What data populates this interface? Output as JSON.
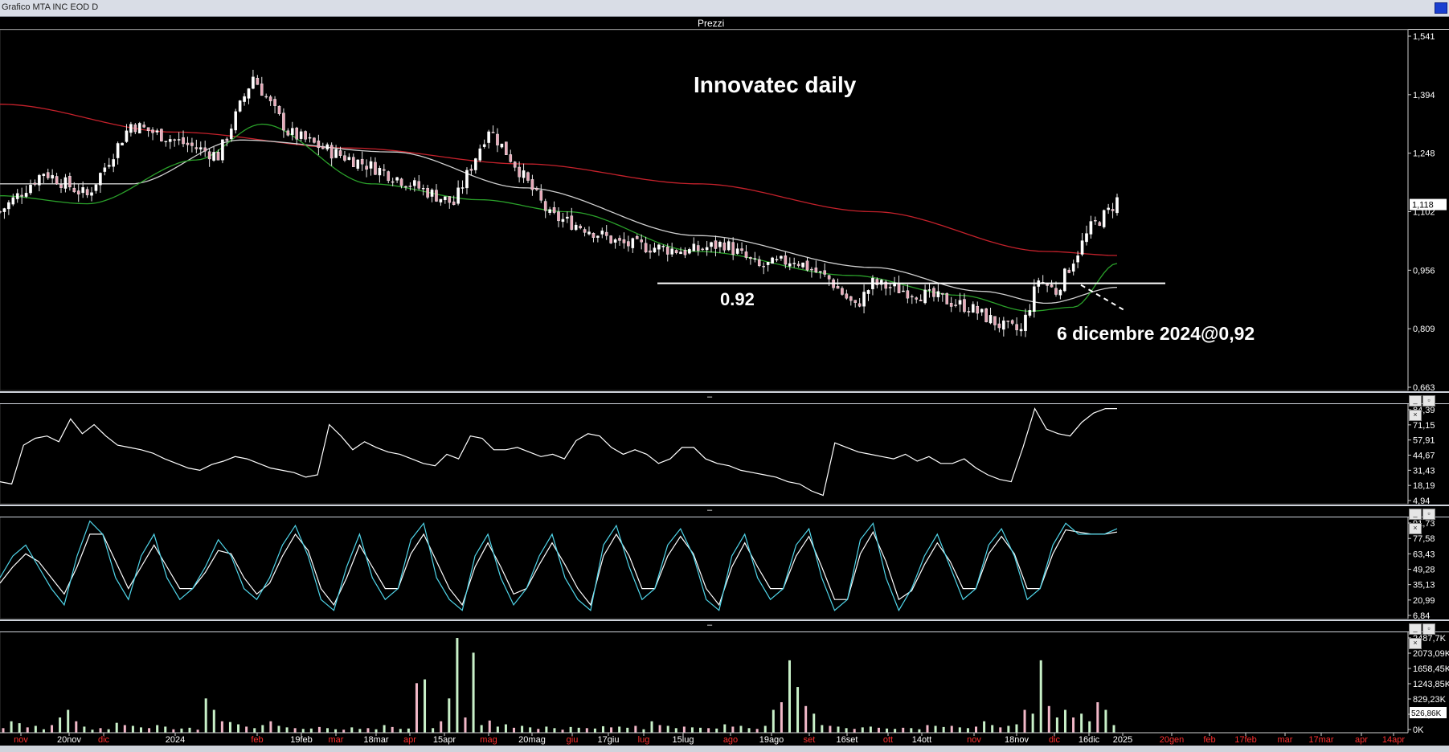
{
  "window": {
    "title": "Grafico MTA INC EOD D"
  },
  "panes": {
    "price_label": "Prezzi"
  },
  "annotations": {
    "title": "Innovatec daily",
    "support_label": "0.92",
    "date_label": "6 dicembre 2024@0,92"
  },
  "colors": {
    "background": "#000000",
    "ma_long": "#c4212b",
    "ma_mid": "#cfcfcf",
    "ma_short": "#2aa02a",
    "candle_up": "#ffffff",
    "candle_down": "#e8a8b8",
    "rsi": "#ffffff",
    "stoch_k": "#4fd4e8",
    "stoch_d": "#ffffff",
    "vol_up": "#c8f0c8",
    "vol_down": "#f2b8c8"
  },
  "x_axis": {
    "labels": [
      {
        "t": "nov",
        "c": "#ff3030"
      },
      {
        "t": "20nov",
        "c": "#ffffff"
      },
      {
        "t": "dic",
        "c": "#ff3030"
      },
      {
        "t": "2024",
        "c": "#ffffff"
      },
      {
        "t": "feb",
        "c": "#ff3030"
      },
      {
        "t": "19feb",
        "c": "#ffffff"
      },
      {
        "t": "mar",
        "c": "#ff3030"
      },
      {
        "t": "18mar",
        "c": "#ffffff"
      },
      {
        "t": "apr",
        "c": "#ff3030"
      },
      {
        "t": "15apr",
        "c": "#ffffff"
      },
      {
        "t": "mag",
        "c": "#ff3030"
      },
      {
        "t": "20mag",
        "c": "#ffffff"
      },
      {
        "t": "giu",
        "c": "#ff3030"
      },
      {
        "t": "17giu",
        "c": "#ffffff"
      },
      {
        "t": "lug",
        "c": "#ff3030"
      },
      {
        "t": "15lug",
        "c": "#ffffff"
      },
      {
        "t": "ago",
        "c": "#ff3030"
      },
      {
        "t": "19ago",
        "c": "#ffffff"
      },
      {
        "t": "set",
        "c": "#ff3030"
      },
      {
        "t": "16set",
        "c": "#ffffff"
      },
      {
        "t": "ott",
        "c": "#ff3030"
      },
      {
        "t": "14ott",
        "c": "#ffffff"
      },
      {
        "t": "nov",
        "c": "#ff3030"
      },
      {
        "t": "18nov",
        "c": "#ffffff"
      },
      {
        "t": "dic",
        "c": "#ff3030"
      },
      {
        "t": "16dic",
        "c": "#ffffff"
      },
      {
        "t": "2025",
        "c": "#ffffff"
      },
      {
        "t": "20gen",
        "c": "#ff3030"
      },
      {
        "t": "feb",
        "c": "#ff3030"
      },
      {
        "t": "17feb",
        "c": "#ff3030"
      },
      {
        "t": "mar",
        "c": "#ff3030"
      },
      {
        "t": "17mar",
        "c": "#ff3030"
      },
      {
        "t": "apr",
        "c": "#ff3030"
      },
      {
        "t": "14apr",
        "c": "#ff3030"
      }
    ]
  },
  "chart_data": [
    {
      "type": "candlestick",
      "pane": "Prezzi",
      "title": "Innovatec daily",
      "y_ticks": [
        "1,541",
        "1,394",
        "1,248",
        "1,102",
        "0,956",
        "0,809",
        "0,663"
      ],
      "ylim": [
        0.663,
        1.541
      ],
      "last_price": "1,118",
      "support_level": 0.92,
      "price_path": [
        {
          "x": 0,
          "y": 1.1
        },
        {
          "x": 10,
          "y": 1.2
        },
        {
          "x": 20,
          "y": 1.14
        },
        {
          "x": 30,
          "y": 1.32
        },
        {
          "x": 40,
          "y": 1.28
        },
        {
          "x": 50,
          "y": 1.24
        },
        {
          "x": 58,
          "y": 1.44
        },
        {
          "x": 66,
          "y": 1.3
        },
        {
          "x": 76,
          "y": 1.25
        },
        {
          "x": 86,
          "y": 1.21
        },
        {
          "x": 96,
          "y": 1.16
        },
        {
          "x": 104,
          "y": 1.12
        },
        {
          "x": 112,
          "y": 1.31
        },
        {
          "x": 118,
          "y": 1.22
        },
        {
          "x": 126,
          "y": 1.09
        },
        {
          "x": 134,
          "y": 1.06
        },
        {
          "x": 142,
          "y": 1.02
        },
        {
          "x": 150,
          "y": 1.01
        },
        {
          "x": 158,
          "y": 1.0
        },
        {
          "x": 166,
          "y": 1.02
        },
        {
          "x": 174,
          "y": 0.96
        },
        {
          "x": 182,
          "y": 0.98
        },
        {
          "x": 190,
          "y": 0.93
        },
        {
          "x": 196,
          "y": 0.86
        },
        {
          "x": 200,
          "y": 0.92
        },
        {
          "x": 208,
          "y": 0.9
        },
        {
          "x": 216,
          "y": 0.88
        },
        {
          "x": 222,
          "y": 0.86
        },
        {
          "x": 230,
          "y": 0.81
        },
        {
          "x": 234,
          "y": 0.8
        },
        {
          "x": 238,
          "y": 0.93
        },
        {
          "x": 242,
          "y": 0.9
        },
        {
          "x": 246,
          "y": 0.98
        },
        {
          "x": 250,
          "y": 1.06
        },
        {
          "x": 254,
          "y": 1.1
        },
        {
          "x": 256,
          "y": 1.13
        }
      ],
      "moving_averages": [
        {
          "name": "MA long",
          "color": "#c4212b",
          "points": [
            {
              "x": 0,
              "y": 1.37
            },
            {
              "x": 40,
              "y": 1.3
            },
            {
              "x": 80,
              "y": 1.26
            },
            {
              "x": 120,
              "y": 1.22
            },
            {
              "x": 160,
              "y": 1.17
            },
            {
              "x": 200,
              "y": 1.1
            },
            {
              "x": 240,
              "y": 1.0
            },
            {
              "x": 256,
              "y": 0.99
            }
          ]
        },
        {
          "name": "MA mid",
          "color": "#cfcfcf",
          "points": [
            {
              "x": 0,
              "y": 1.17
            },
            {
              "x": 30,
              "y": 1.17
            },
            {
              "x": 55,
              "y": 1.28
            },
            {
              "x": 90,
              "y": 1.25
            },
            {
              "x": 120,
              "y": 1.16
            },
            {
              "x": 160,
              "y": 1.04
            },
            {
              "x": 200,
              "y": 0.96
            },
            {
              "x": 225,
              "y": 0.9
            },
            {
              "x": 240,
              "y": 0.87
            },
            {
              "x": 256,
              "y": 0.91
            }
          ]
        },
        {
          "name": "MA short",
          "color": "#2aa02a",
          "points": [
            {
              "x": 0,
              "y": 1.14
            },
            {
              "x": 20,
              "y": 1.12
            },
            {
              "x": 45,
              "y": 1.23
            },
            {
              "x": 60,
              "y": 1.32
            },
            {
              "x": 85,
              "y": 1.17
            },
            {
              "x": 110,
              "y": 1.13
            },
            {
              "x": 130,
              "y": 1.1
            },
            {
              "x": 160,
              "y": 1.0
            },
            {
              "x": 195,
              "y": 0.94
            },
            {
              "x": 220,
              "y": 0.89
            },
            {
              "x": 236,
              "y": 0.85
            },
            {
              "x": 246,
              "y": 0.86
            },
            {
              "x": 256,
              "y": 0.97
            }
          ]
        }
      ]
    },
    {
      "type": "line",
      "pane": "oscillator-1",
      "y_ticks": [
        "84,39",
        "71,15",
        "57,91",
        "44,67",
        "31,43",
        "18,19",
        "4,94"
      ],
      "ylim": [
        4.94,
        84.39
      ],
      "series": [
        {
          "values": [
            20,
            18,
            52,
            58,
            60,
            55,
            75,
            62,
            70,
            60,
            52,
            50,
            48,
            45,
            40,
            36,
            32,
            30,
            35,
            38,
            42,
            40,
            36,
            32,
            30,
            28,
            24,
            26,
            70,
            60,
            48,
            55,
            50,
            46,
            44,
            40,
            36,
            34,
            44,
            40,
            60,
            58,
            48,
            48,
            50,
            46,
            42,
            44,
            40,
            56,
            62,
            60,
            50,
            44,
            48,
            44,
            36,
            40,
            50,
            50,
            40,
            36,
            34,
            30,
            28,
            26,
            24,
            20,
            18,
            12,
            8,
            54,
            50,
            46,
            44,
            42,
            40,
            44,
            38,
            42,
            36,
            36,
            40,
            32,
            26,
            22,
            20,
            50,
            84,
            66,
            62,
            60,
            72,
            80,
            84,
            84
          ]
        }
      ]
    },
    {
      "type": "line",
      "pane": "oscillator-2",
      "y_ticks": [
        "91,73",
        "77,58",
        "63,43",
        "49,28",
        "35,13",
        "20,99",
        "6,84"
      ],
      "ylim": [
        6.84,
        91.73
      ],
      "series": [
        {
          "name": "K",
          "values": [
            40,
            60,
            70,
            50,
            30,
            15,
            60,
            92,
            80,
            40,
            20,
            60,
            80,
            40,
            20,
            30,
            50,
            75,
            60,
            30,
            20,
            40,
            70,
            88,
            60,
            20,
            10,
            50,
            80,
            40,
            20,
            30,
            75,
            90,
            40,
            20,
            10,
            60,
            80,
            40,
            15,
            30,
            60,
            80,
            40,
            20,
            10,
            70,
            88,
            50,
            20,
            30,
            70,
            85,
            60,
            20,
            10,
            60,
            80,
            40,
            20,
            30,
            70,
            85,
            40,
            10,
            20,
            75,
            90,
            40,
            10,
            30,
            60,
            80,
            50,
            20,
            30,
            70,
            85,
            60,
            20,
            30,
            70,
            90,
            80,
            80,
            80,
            85
          ]
        },
        {
          "name": "D",
          "values": [
            35,
            50,
            62,
            55,
            40,
            25,
            50,
            80,
            80,
            55,
            30,
            50,
            70,
            50,
            30,
            30,
            45,
            65,
            62,
            40,
            25,
            35,
            60,
            80,
            65,
            30,
            15,
            40,
            70,
            50,
            30,
            30,
            62,
            80,
            55,
            30,
            15,
            50,
            72,
            50,
            25,
            30,
            52,
            72,
            52,
            30,
            15,
            60,
            80,
            60,
            30,
            30,
            60,
            78,
            62,
            30,
            15,
            50,
            72,
            50,
            30,
            30,
            60,
            78,
            50,
            20,
            20,
            62,
            82,
            55,
            20,
            28,
            52,
            72,
            55,
            30,
            30,
            62,
            78,
            62,
            30,
            30,
            62,
            84,
            82,
            80,
            80,
            82
          ]
        }
      ]
    },
    {
      "type": "bar",
      "pane": "volume",
      "y_ticks": [
        "2487,7K",
        "2073,09K",
        "1658,45K",
        "1243,85K",
        "829,23K",
        "526,86K",
        "0K"
      ],
      "ylim": [
        0,
        2487.7
      ],
      "last_value": "526,86K",
      "values": [
        120,
        300,
        250,
        140,
        180,
        90,
        200,
        400,
        600,
        300,
        160,
        80,
        120,
        90,
        260,
        200,
        180,
        140,
        120,
        200,
        160,
        90,
        110,
        130,
        80,
        900,
        600,
        300,
        280,
        220,
        160,
        120,
        200,
        300,
        180,
        140,
        120,
        100,
        110,
        150,
        120,
        90,
        80,
        140,
        100,
        120,
        90,
        200,
        150,
        100,
        110,
        1300,
        1400,
        120,
        300,
        900,
        2487,
        400,
        2100,
        200,
        320,
        160,
        220,
        130,
        180,
        140,
        100,
        160,
        120,
        80,
        150,
        130,
        120,
        110,
        170,
        140,
        160,
        130,
        180,
        90,
        300,
        200,
        180,
        120,
        160,
        140,
        130,
        120,
        110,
        220,
        160,
        180,
        120,
        100,
        180,
        600,
        800,
        1900,
        1200,
        700,
        500,
        200,
        180,
        160,
        120,
        100,
        140,
        160,
        130,
        110,
        100,
        130,
        120,
        90,
        200,
        180,
        150,
        180,
        140,
        120,
        160,
        300,
        200,
        140,
        180,
        220,
        600,
        500,
        1900,
        700,
        400,
        600,
        400,
        500,
        300,
        800,
        600,
        200
      ]
    }
  ]
}
